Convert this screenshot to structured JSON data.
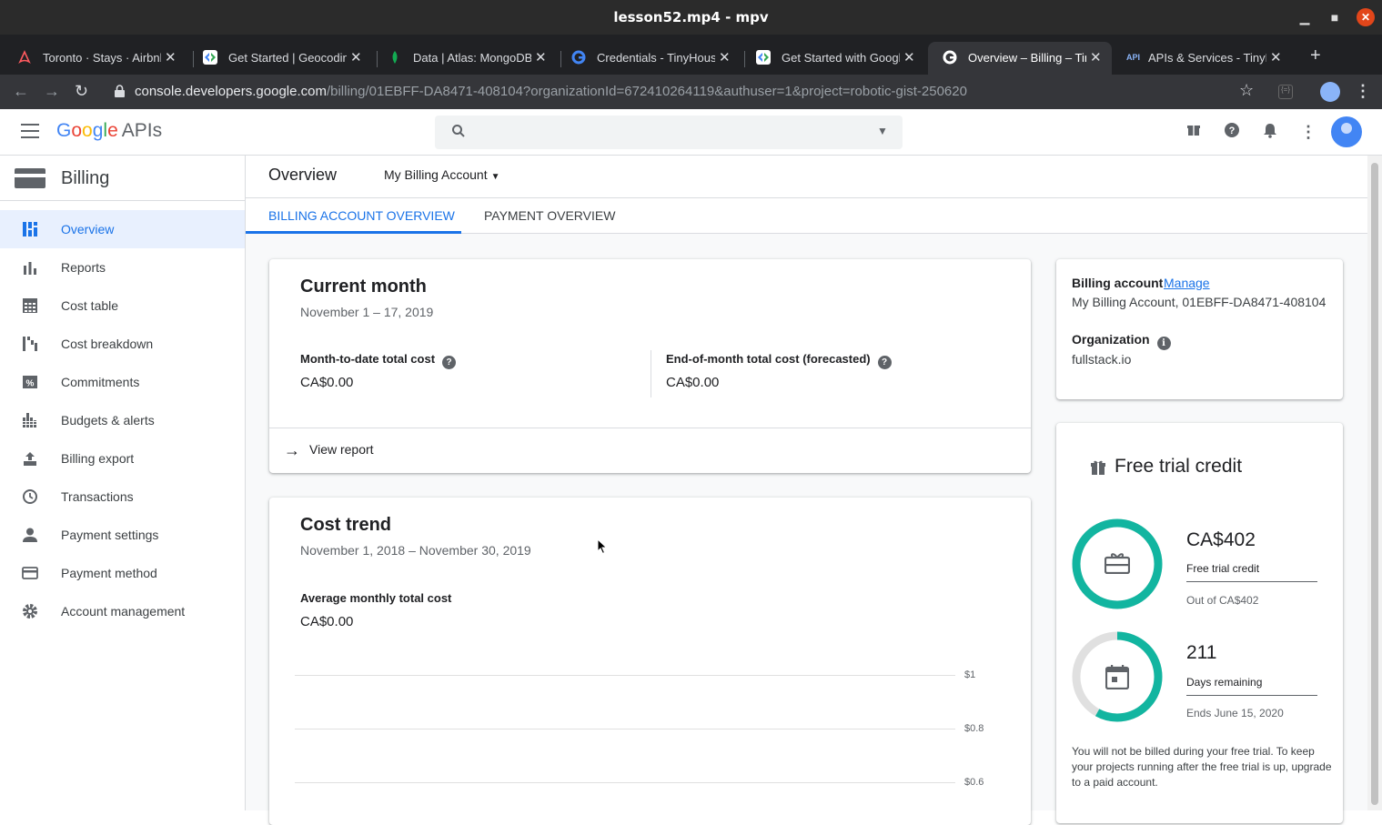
{
  "window": {
    "title": "lesson52.mp4 - mpv"
  },
  "tabs": [
    {
      "label": "Toronto · Stays · Airbnb",
      "icon": "airbnb-icon",
      "color": "#ff5a5f"
    },
    {
      "label": "Get Started | Geocoding",
      "icon": "google-dev-icon",
      "color": "#4285f4"
    },
    {
      "label": "Data | Atlas: MongoDB",
      "icon": "mongodb-leaf-icon",
      "color": "#13aa52"
    },
    {
      "label": "Credentials - TinyHouse",
      "icon": "google-g-icon",
      "color": "#ea4335"
    },
    {
      "label": "Get Started with Google",
      "icon": "google-dev-icon",
      "color": "#4285f4"
    },
    {
      "label": "Overview – Billing – TinyHouse",
      "icon": "google-g-icon",
      "color": "#ea4335",
      "active": true
    },
    {
      "label": "APIs & Services - TinyHouse",
      "icon": "api-icon",
      "color": "#1a73e8"
    }
  ],
  "address": {
    "host": "console.developers.google.com",
    "path": "/billing/01EBFF-DA8471-408104?organizationId=672410264119&authuser=1&project=robotic-gist-250620"
  },
  "header": {
    "logo_google": "Google",
    "logo_apis": "APIs"
  },
  "sidebar": {
    "title": "Billing",
    "items": [
      {
        "label": "Overview",
        "icon": "dashboard-icon",
        "active": true
      },
      {
        "label": "Reports",
        "icon": "bar-chart-icon"
      },
      {
        "label": "Cost table",
        "icon": "table-icon"
      },
      {
        "label": "Cost breakdown",
        "icon": "waterfall-icon"
      },
      {
        "label": "Commitments",
        "icon": "percent-icon"
      },
      {
        "label": "Budgets & alerts",
        "icon": "budgets-icon"
      },
      {
        "label": "Billing export",
        "icon": "upload-icon"
      },
      {
        "label": "Transactions",
        "icon": "clock-icon"
      },
      {
        "label": "Payment settings",
        "icon": "person-icon"
      },
      {
        "label": "Payment method",
        "icon": "credit-card-icon"
      },
      {
        "label": "Account management",
        "icon": "gear-icon"
      }
    ]
  },
  "page": {
    "title": "Overview",
    "account": "My Billing Account",
    "tabs": [
      "BILLING ACCOUNT OVERVIEW",
      "PAYMENT OVERVIEW"
    ]
  },
  "current_month": {
    "title": "Current month",
    "range": "November 1 – 17, 2019",
    "mtd_label": "Month-to-date total cost",
    "mtd_value": "CA$0.00",
    "eom_label": "End-of-month total cost (forecasted)",
    "eom_value": "CA$0.00",
    "view_report": "View report"
  },
  "cost_trend": {
    "title": "Cost trend",
    "range": "November 1, 2018 – November 30, 2019",
    "avg_label": "Average monthly total cost",
    "avg_value": "CA$0.00",
    "gridlines": [
      "$1",
      "$0.8",
      "$0.6"
    ]
  },
  "billing_account": {
    "label": "Billing account",
    "manage": "Manage",
    "value": "My Billing Account, 01EBFF-DA8471-408104",
    "org_label": "Organization",
    "org_value": "fullstack.io"
  },
  "free_trial": {
    "title": "Free trial credit",
    "credit_value": "CA$402",
    "credit_label": "Free trial credit",
    "credit_out_of": "Out of CA$402",
    "credit_fraction": 1.0,
    "days_value": "211",
    "days_label": "Days remaining",
    "days_ends": "Ends June 15, 2020",
    "days_fraction": 0.58,
    "note": "You will not be billed during your free trial. To keep your projects running after the free trial is up, upgrade to a paid account.",
    "accent": "#12b5a0"
  }
}
